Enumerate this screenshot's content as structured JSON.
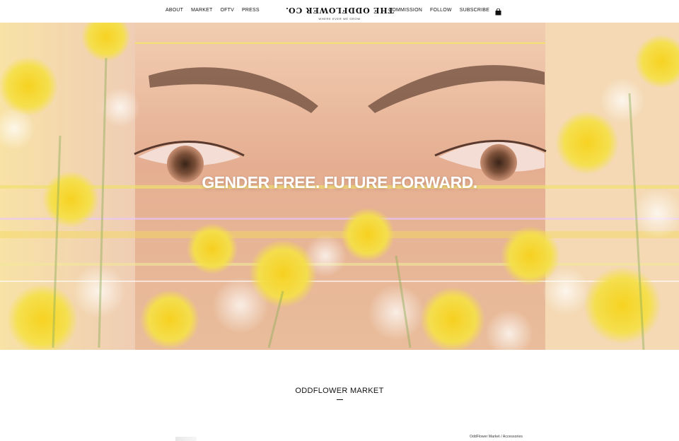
{
  "header": {
    "nav_left": [
      "ABOUT",
      "MARKET",
      "OFTV",
      "PRESS"
    ],
    "nav_right": [
      "COMMISSION",
      "FOLLOW",
      "SUBSCRIBE"
    ],
    "logo_text": "THE ODDFLOWER CO.",
    "logo_tagline": "WHERE EVER WE GROW",
    "cart_icon": "shopping-bag-icon"
  },
  "hero": {
    "headline": "GENDER FREE. FUTURE FORWARD."
  },
  "market": {
    "title": "ODDFLOWER MARKET",
    "breadcrumb": "OddFlower Market / Accessories"
  },
  "colors": {
    "text": "#111111",
    "background": "#ffffff",
    "hero_yellow": "#f5e04a",
    "hero_skin": "#e9b89a"
  }
}
